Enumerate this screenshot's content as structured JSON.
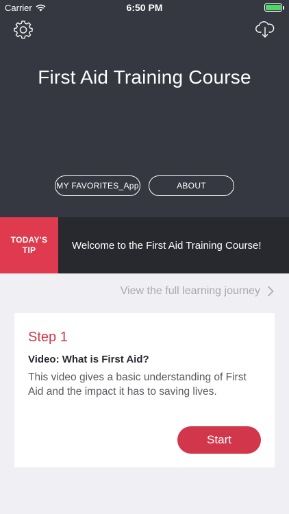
{
  "status_bar": {
    "carrier": "Carrier",
    "time": "6:50 PM",
    "battery_color": "#4cd964"
  },
  "header": {
    "title": "First Aid Training Course",
    "favorites_label": "MY FAVORITES_App",
    "about_label": "ABOUT",
    "left_icon": "gear-icon",
    "right_icon": "cloud-download-icon"
  },
  "tip": {
    "badge": "TODAY'S TIP",
    "message": "Welcome to the First Aid Training Course!"
  },
  "journey_link": "View the full learning journey",
  "card": {
    "step": "Step 1",
    "title": "Video: What is First Aid?",
    "description": "This video gives a basic understanding of First Aid and the impact it has to saving lives.",
    "start_label": "Start"
  },
  "colors": {
    "hero_bg": "#353841",
    "tip_bg": "#27292f",
    "accent": "#d2364a",
    "tip_badge": "#e03a4e",
    "page_bg": "#efeff4"
  }
}
